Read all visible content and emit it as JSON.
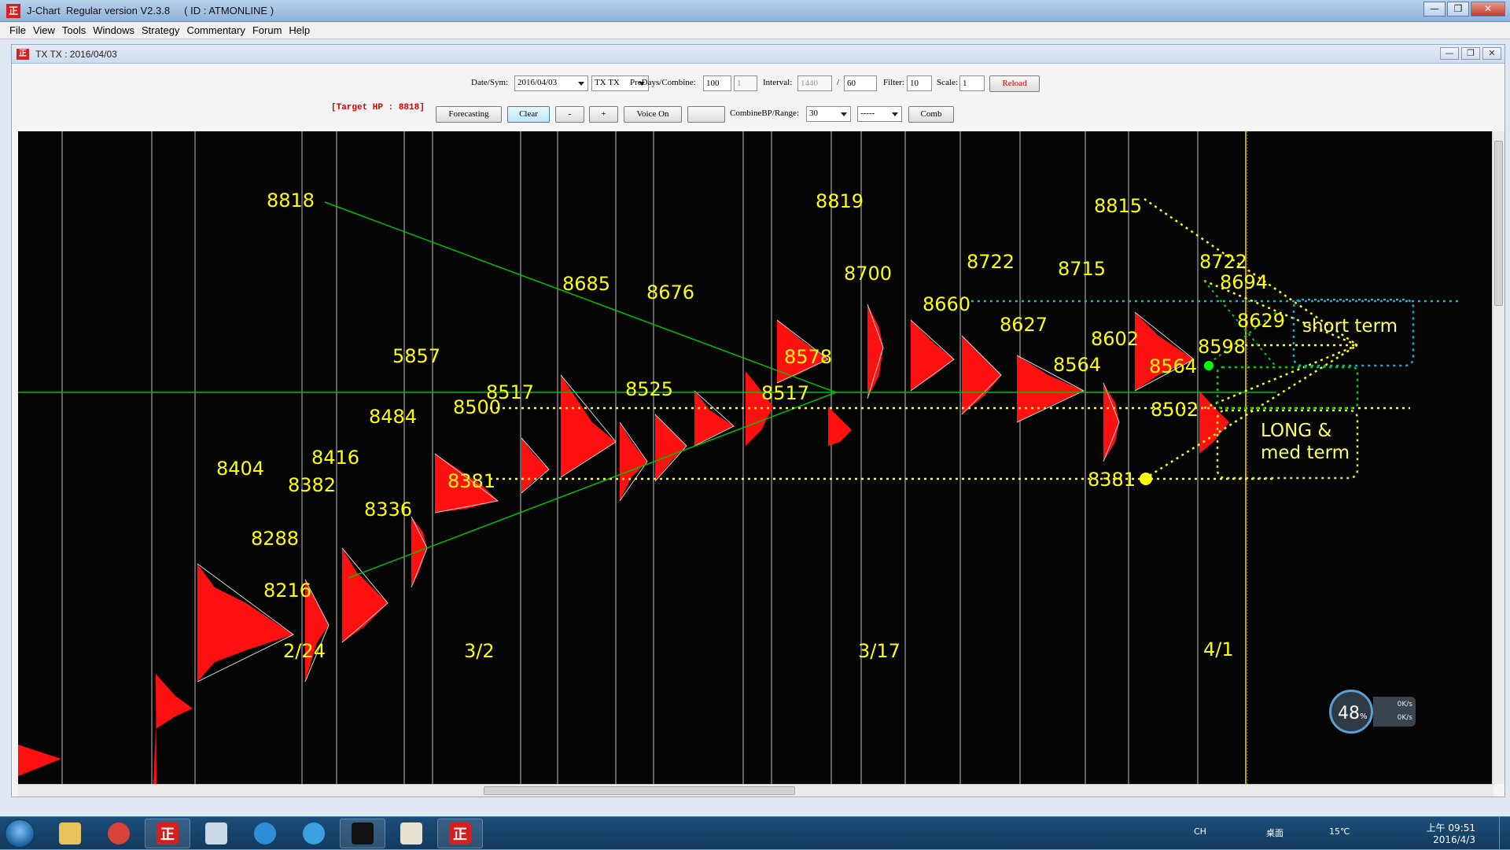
{
  "app": {
    "title": "J-Chart  Regular version V2.3.8     ( ID : ATMONLINE )",
    "icon_letter": "正",
    "window_buttons": [
      "—",
      "❐",
      "✕"
    ]
  },
  "menu": [
    "File",
    "View",
    "Tools",
    "Windows",
    "Strategy",
    "Commentary",
    "Forum",
    "Help"
  ],
  "child": {
    "title": "TX TX : 2016/04/03",
    "buttons": [
      "—",
      "❐",
      "✕"
    ]
  },
  "toolbar": {
    "date_sym_label": "Date/Sym:",
    "date_value": "2016/04/03",
    "sym_value": "TX TX",
    "predays_label": "PreDays/Combine:",
    "predays_value": "100",
    "combine_value": "1",
    "interval_label": "Interval:",
    "interval_value": "1440",
    "interval_sep": "/",
    "interval_value2": "60",
    "filter_label": "Filter:",
    "filter_value": "10",
    "scale_label": "Scale:",
    "scale_value": "1",
    "reload_label": "Reload",
    "target_hp": "[Target HP : 8818]",
    "forecasting_label": "Forecasting",
    "clear_label": "Clear",
    "minus_label": "-",
    "plus_label": "+",
    "voice_label": "Voice On",
    "blank_label": "",
    "combine_range_label": "CombineBP/Range:",
    "combine_range_value": "30",
    "range_value": "-----",
    "comb_label": "Comb"
  },
  "chart_data": {
    "type": "market-profile",
    "price_labels": [
      "8818",
      "8685",
      "8676",
      "8819",
      "8815",
      "8722",
      "8694",
      "8629",
      "8598",
      "8564",
      "8502",
      "8381",
      "8700",
      "8660",
      "8627",
      "8722",
      "8715",
      "8602",
      "8564",
      "5857",
      "8517",
      "8500",
      "8525",
      "8517",
      "8578",
      "8484",
      "8381",
      "8404",
      "8416",
      "8382",
      "8336",
      "8288",
      "8216"
    ],
    "date_labels": [
      "2/24",
      "3/2",
      "3/17",
      "4/1"
    ],
    "horizontal_levels": [
      8660,
      8517,
      8502,
      8381
    ],
    "target_hp": 8818,
    "annotations": [
      "short term",
      "LONG &",
      "med term"
    ],
    "colors": {
      "profile": "#ff0000",
      "label": "#ffff00",
      "trendline": "#00c000",
      "level_cyan": "#00bcd4",
      "level_yellow": "#ffff00",
      "background": "#050505"
    }
  },
  "widget": {
    "percent": "48",
    "percent_sign": "%",
    "up": "0K/s",
    "down": "0K/s"
  },
  "taskbar": {
    "tray_lang": "CH",
    "tray_desktop": "桌面",
    "tray_temp": "15℃",
    "clock_time": "上午 09:51",
    "clock_date": "2016/4/3"
  }
}
